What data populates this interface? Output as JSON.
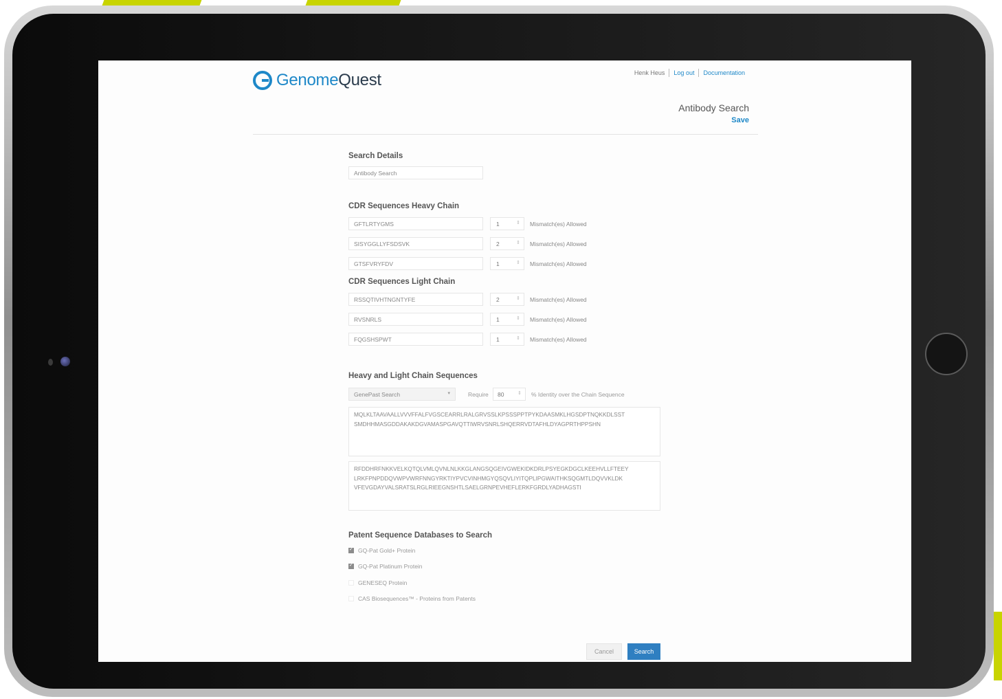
{
  "brand": {
    "name_part1": "Genome",
    "name_part2": "Quest",
    "accent_color": "#1e88c8",
    "frame_accent": "#c8d400"
  },
  "header": {
    "user": "Henk Heus",
    "logout": "Log out",
    "documentation": "Documentation",
    "page_title": "Antibody Search",
    "save": "Save"
  },
  "search_details": {
    "heading": "Search Details",
    "name_value": "Antibody Search"
  },
  "heavy_chain": {
    "heading": "CDR Sequences Heavy Chain",
    "rows": [
      {
        "sequence": "GFTLRTYGMS",
        "mismatch": "1",
        "label": "Mismatch(es) Allowed"
      },
      {
        "sequence": "SISYGGLLYFSDSVK",
        "mismatch": "2",
        "label": "Mismatch(es) Allowed"
      },
      {
        "sequence": "GTSFVRYFDV",
        "mismatch": "1",
        "label": "Mismatch(es) Allowed"
      }
    ]
  },
  "light_chain": {
    "heading": "CDR Sequences Light Chain",
    "rows": [
      {
        "sequence": "RSSQTIVHTNGNTYFE",
        "mismatch": "2",
        "label": "Mismatch(es) Allowed"
      },
      {
        "sequence": "RVSNRLS",
        "mismatch": "1",
        "label": "Mismatch(es) Allowed"
      },
      {
        "sequence": "FQGSHSPWT",
        "mismatch": "1",
        "label": "Mismatch(es) Allowed"
      }
    ]
  },
  "chain_sequences": {
    "heading": "Heavy and Light Chain Sequences",
    "method": "GenePast Search",
    "require_label": "Require",
    "require_value": "80",
    "identity_label": "% Identity over the Chain Sequence",
    "heavy_lines": [
      "MQLKLTAAVAALLVVVFFALFVGSCEARRLRALGRVSSLKPSSSPPTPYKDAASMKLHGSDPTNQKKDLSST",
      "SMDHHMASGDDAKAKDGVAMASPGAVQTTIWRVSNRLSHQERRVDTAFHLDYAGPRTHPPSHN"
    ],
    "light_lines": [
      "RFDDHRFNKKVELKQTQLVMLQVNLNLKKGLANGSQGEIVGWEKIDKDRLPSYEGKDGCLKEEHVLLFTEEY",
      "LRKFPNPDDQVWPVWRFNNGYRKTIYPVCVINHMGYQSQVLIYITQPLIPGWAITHKSQGMTLDQVVKLDK",
      "VFEVGDAYVALSRATSLRGLRIEEGNSHTLSAELGRNPEVHEFLERKFGRDLYADHAGSTI"
    ]
  },
  "databases": {
    "heading": "Patent Sequence Databases to Search",
    "items": [
      {
        "label": "GQ-Pat Gold+ Protein",
        "checked": true
      },
      {
        "label": "GQ-Pat Platinum Protein",
        "checked": true
      },
      {
        "label": "GENESEQ Protein",
        "checked": false
      },
      {
        "label": "CAS Biosequences™ - Proteins from Patents",
        "checked": false
      }
    ]
  },
  "actions": {
    "cancel": "Cancel",
    "search": "Search"
  }
}
